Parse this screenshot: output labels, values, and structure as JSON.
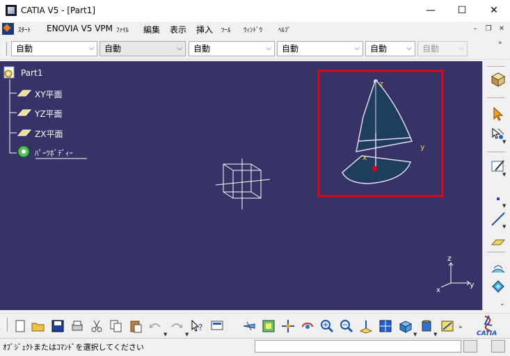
{
  "window": {
    "title": "CATIA V5 - [Part1]",
    "minimize": "—",
    "maximize": "☐",
    "close": "✕"
  },
  "menu": {
    "start": "ｽﾀｰﾄ",
    "enovia": "ENOVIA V5 VPM",
    "file": "ﾌｧｲﾙ",
    "edit": "編集",
    "view": "表示",
    "insert": "挿入",
    "tools": "ﾂｰﾙ",
    "window": "ｳｨﾝﾄﾞｳ",
    "help": "ﾍﾙﾌﾟ"
  },
  "combos": [
    {
      "value": "自動",
      "enabled": true
    },
    {
      "value": "自動",
      "enabled": true
    },
    {
      "value": "自動",
      "enabled": true
    },
    {
      "value": "自動",
      "enabled": true
    },
    {
      "value": "自動",
      "enabled": true
    },
    {
      "value": "自動",
      "enabled": false
    }
  ],
  "tree": {
    "root": "Part1",
    "items": [
      {
        "label": "XY平面",
        "icon": "plane-icon"
      },
      {
        "label": "YZ平面",
        "icon": "plane-icon"
      },
      {
        "label": "ZX平面",
        "icon": "plane-icon"
      },
      {
        "label": "ﾊﾟｰﾂﾎﾞﾃﾞｨｰ",
        "icon": "part-body-icon"
      }
    ]
  },
  "compass": {
    "z": "z",
    "x": "x",
    "y": "y"
  },
  "axis_triad": {
    "z": "z",
    "x": "x",
    "y": "y"
  },
  "highlight_color": "#e30613",
  "viewport_color": "#363467",
  "status": {
    "prompt": "ｵﾌﾞｼﾞｪｸﾄまたはｺﾏﾝﾄﾞを選択してください"
  },
  "brand": {
    "name": "CATIA"
  }
}
